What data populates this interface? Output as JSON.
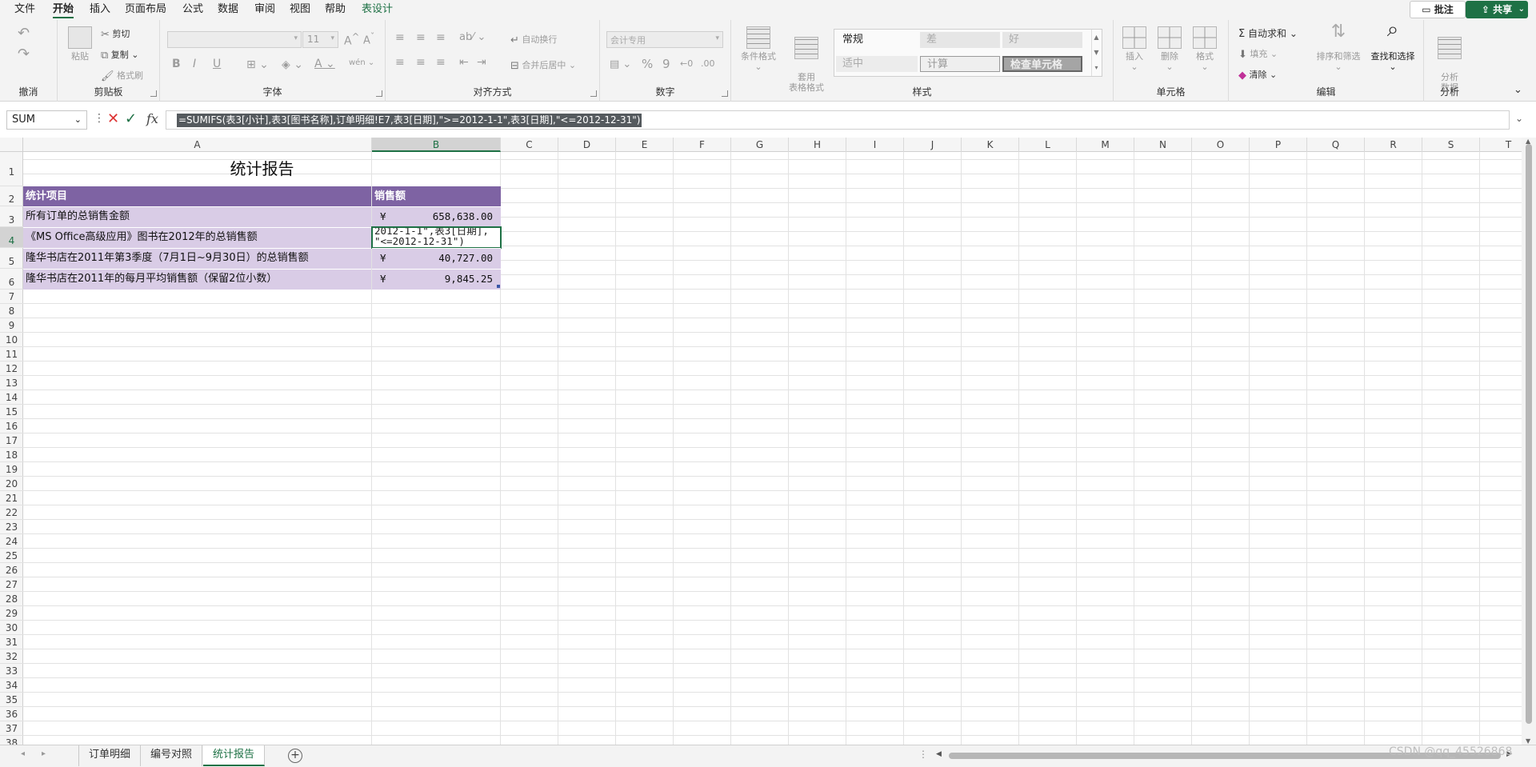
{
  "menu": {
    "tabs": [
      "文件",
      "开始",
      "插入",
      "页面布局",
      "公式",
      "数据",
      "审阅",
      "视图",
      "帮助",
      "表设计"
    ],
    "comment_label": "批注",
    "share_label": "共享"
  },
  "ribbon": {
    "undo_group": "撤消",
    "clipboard": {
      "paste": "粘贴",
      "cut": "剪切",
      "copy": "复制",
      "format_painter": "格式刷",
      "label": "剪贴板"
    },
    "font": {
      "size": "11",
      "bold": "B",
      "italic": "I",
      "underline": "U",
      "label": "字体"
    },
    "alignment": {
      "wrap": "自动换行",
      "merge": "合并后居中",
      "label": "对齐方式"
    },
    "number": {
      "format": "会计专用",
      "percent": "%",
      "comma": "9",
      "label": "数字"
    },
    "styles_btns": {
      "conditional": "条件格式",
      "table_format": "套用\n表格格式"
    },
    "styles": {
      "cells": [
        "常规",
        "差",
        "好",
        "适中",
        "计算",
        "检查单元格"
      ],
      "label": "样式"
    },
    "cells_group": {
      "insert": "插入",
      "delete": "删除",
      "format": "格式",
      "label": "单元格"
    },
    "editing": {
      "autosum": "自动求和",
      "fill": "填充",
      "clear": "清除",
      "sort": "排序和筛选",
      "find": "查找和选择",
      "label": "编辑"
    },
    "analysis": {
      "btn": "分析\n数据",
      "label": "分析"
    }
  },
  "formula_bar": {
    "name_box": "SUM",
    "formula": "=SUMIFS(表3[小计],表3[图书名称],订单明细!E7,表3[日期],\">=2012-1-1\",表3[日期],\"<=2012-12-31\")"
  },
  "sheet": {
    "columns": [
      "A",
      "B",
      "C",
      "D",
      "E",
      "F",
      "G",
      "H",
      "I",
      "J",
      "K",
      "L",
      "M",
      "N",
      "O",
      "P",
      "Q",
      "R",
      "S",
      "T"
    ],
    "rows": [
      "1",
      "2",
      "3",
      "4",
      "5",
      "6",
      "7",
      "8",
      "9",
      "10",
      "11",
      "12",
      "13",
      "14",
      "15",
      "16",
      "17",
      "18",
      "19",
      "20",
      "21",
      "22",
      "23",
      "24",
      "25",
      "26",
      "27",
      "28",
      "29",
      "30",
      "31",
      "32",
      "33",
      "34",
      "35",
      "36",
      "37",
      "38"
    ],
    "title": "统计报告",
    "header": {
      "item": "统计项目",
      "sales": "销售额"
    },
    "data": [
      {
        "item": "所有订单的总销售金额",
        "currency": "¥",
        "value": "658,638.00"
      },
      {
        "item": "《MS Office高级应用》图书在2012年的总销售额",
        "editing_line1": "2012-1-1\",表3[日期],",
        "editing_line2": "\"<=2012-12-31\")"
      },
      {
        "item": "隆华书店在2011年第3季度（7月1日~9月30日）的总销售额",
        "currency": "¥",
        "value": "40,727.00"
      },
      {
        "item": "隆华书店在2011年的每月平均销售额（保留2位小数）",
        "currency": "¥",
        "value": "9,845.25"
      }
    ]
  },
  "sheet_tabs": [
    "订单明细",
    "编号对照",
    "统计报告"
  ],
  "watermark": "CSDN @qq_45526868",
  "colors": {
    "accent": "#1e7145",
    "table_header": "#7e63a3",
    "table_row": "#d9cce6"
  }
}
